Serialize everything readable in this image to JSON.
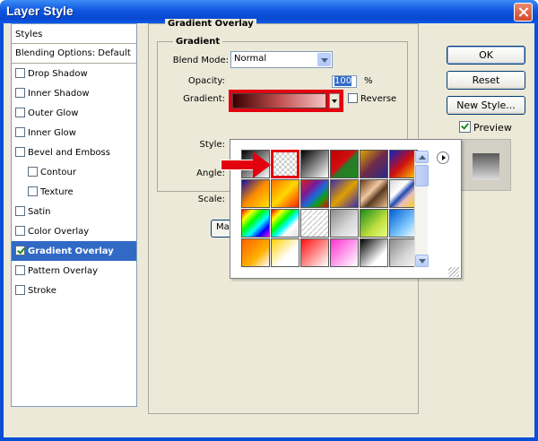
{
  "window": {
    "title": "Layer Style"
  },
  "styles_panel": {
    "header": "Styles",
    "blending": "Blending Options: Default",
    "items": [
      {
        "label": "Drop Shadow",
        "checked": false,
        "indent": false,
        "selected": false
      },
      {
        "label": "Inner Shadow",
        "checked": false,
        "indent": false,
        "selected": false
      },
      {
        "label": "Outer Glow",
        "checked": false,
        "indent": false,
        "selected": false
      },
      {
        "label": "Inner Glow",
        "checked": false,
        "indent": false,
        "selected": false
      },
      {
        "label": "Bevel and Emboss",
        "checked": false,
        "indent": false,
        "selected": false
      },
      {
        "label": "Contour",
        "checked": false,
        "indent": true,
        "selected": false
      },
      {
        "label": "Texture",
        "checked": false,
        "indent": true,
        "selected": false
      },
      {
        "label": "Satin",
        "checked": false,
        "indent": false,
        "selected": false
      },
      {
        "label": "Color Overlay",
        "checked": false,
        "indent": false,
        "selected": false
      },
      {
        "label": "Gradient Overlay",
        "checked": true,
        "indent": false,
        "selected": true
      },
      {
        "label": "Pattern Overlay",
        "checked": false,
        "indent": false,
        "selected": false
      },
      {
        "label": "Stroke",
        "checked": false,
        "indent": false,
        "selected": false
      }
    ]
  },
  "gradient_overlay": {
    "section_title": "Gradient Overlay",
    "group_title": "Gradient",
    "blend_mode_label": "Blend Mode:",
    "blend_mode_value": "Normal",
    "opacity_label": "Opacity:",
    "opacity_value": "100",
    "opacity_unit": "%",
    "opacity_slider": 1.0,
    "gradient_label": "Gradient:",
    "reverse_label": "Reverse",
    "style_label": "Style:",
    "angle_label": "Angle:",
    "scale_label": "Scale:",
    "partial_button": "Ma"
  },
  "buttons": {
    "ok": "OK",
    "reset": "Reset",
    "new_style": "New Style...",
    "preview": "Preview"
  },
  "gradient_presets": [
    "linear-gradient(135deg,#000 0%,#fff 100%)",
    "checker",
    "linear-gradient(135deg,#000,#fff)",
    "linear-gradient(135deg,#c00000,#d01010 45%,#2a7a2a 55%,#1a8a1a)",
    "linear-gradient(135deg,#d9a200,#6e2a4a 50%,#2a2a8a)",
    "linear-gradient(135deg,#1020c0,#d01010 50%,#ffd000)",
    "linear-gradient(135deg,#1010a0,#ff8c00 50%,#ffe000)",
    "linear-gradient(135deg,#ff7000,#ffd800 50%,#ff2000)",
    "linear-gradient(135deg,#d8201a,#7a1a9a 33%,#1a6ad8 55%,#10a010 75%,#ff0000)",
    "linear-gradient(135deg,#3a2ab0,#e0a000 50%,#3a2ab0)",
    "linear-gradient(135deg,#6a3a1a,#f0c8a0 40%,#5a3a20 60%,#e8c090)",
    "linear-gradient(135deg,#d8d8d8,#ffffff 35%,#204ab0 50%,#e8c0c0 65%,#ffd000)",
    "linear-gradient(135deg,#ff0000,#ffff00 20%,#00ff00 40%,#00ffff 60%,#0000ff 80%,#ff00ff)",
    "rainbow-checker",
    "stripes-checker",
    "grey-checker",
    "linear-gradient(135deg,#1a8a1a,#c0e040 60%,#e8ff80)",
    "linear-gradient(135deg,#0060d0,#80c8ff 60%,#ffffff)",
    "linear-gradient(135deg,#ff6000,#ffb000 60%,#ffffff)",
    "linear-gradient(135deg,#ffd000,#ffffff 60%,#ffffff)",
    "linear-gradient(135deg,#ff1010,#ffa0a0 60%,#ffffff)",
    "linear-gradient(135deg,#ff30d0,#ffb0f0 60%,#ffffff)",
    "linear-gradient(135deg,#000,#ffffff 70%)",
    "grey-checker"
  ]
}
